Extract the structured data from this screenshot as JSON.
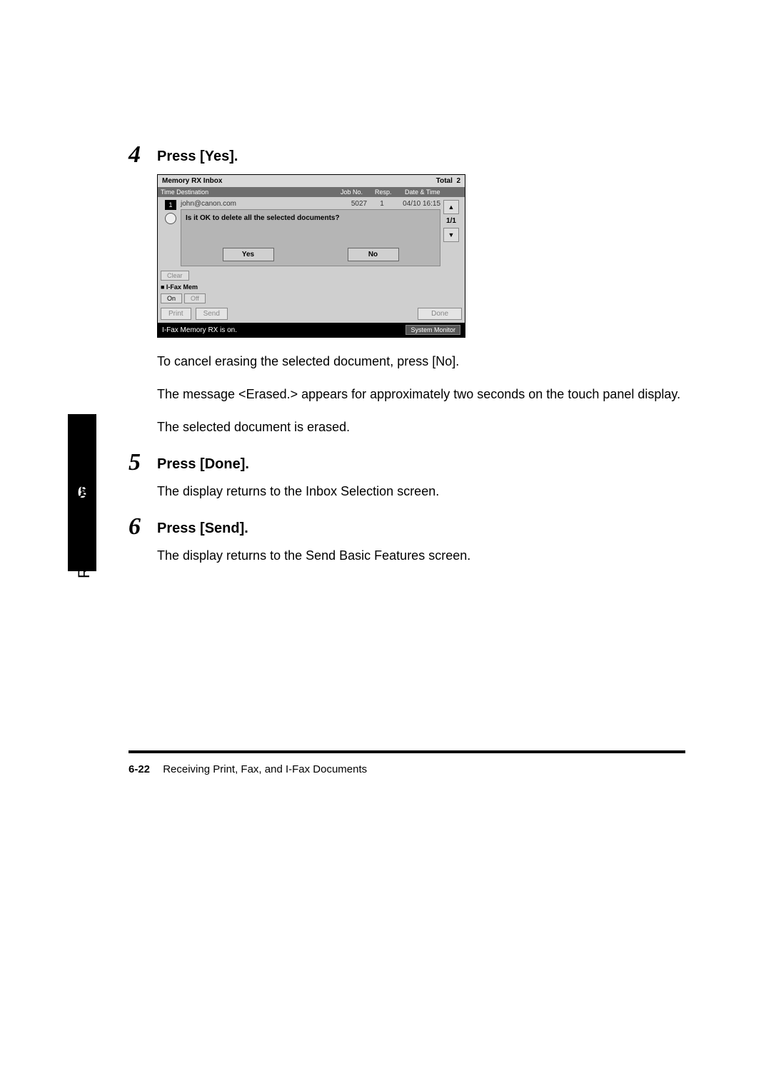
{
  "tab_number": "6",
  "side_label": "Receiving Documents",
  "steps": {
    "s4": {
      "num": "4",
      "title": "Press [Yes]."
    },
    "s5": {
      "num": "5",
      "title": "Press [Done]."
    },
    "s6": {
      "num": "6",
      "title": "Press [Send]."
    }
  },
  "body": {
    "p1": "To cancel erasing the selected document, press [No].",
    "p2": "The message <Erased.> appears for approximately two seconds on the touch panel display.",
    "p3": "The selected document is erased.",
    "p5": "The display returns to the Inbox Selection screen.",
    "p6": "The display returns to the Send Basic Features screen."
  },
  "shot": {
    "title": "Memory RX Inbox",
    "total_label": "Total",
    "total_value": "2",
    "hdr_dest": "Time   Destination",
    "hdr_jobno": "Job No.",
    "hdr_resp": "Resp.",
    "hdr_date": "Date & Time",
    "row_index": "1",
    "mail": "john@canon.com",
    "jobno": "5027",
    "resp": "1",
    "date": "04/10 16:15",
    "dialog_q": "Is it OK to delete all the selected documents?",
    "yes": "Yes",
    "no": "No",
    "page": "1/1",
    "clear": "Clear",
    "ifax_label": "■ I-Fax Mem",
    "on": "On",
    "off": "Off",
    "print": "Print",
    "send": "Send",
    "done": "Done",
    "status": "I-Fax Memory RX is on.",
    "sysmon": "System Monitor"
  },
  "footer": {
    "pageno": "6-22",
    "title": "Receiving Print, Fax, and I-Fax Documents"
  }
}
